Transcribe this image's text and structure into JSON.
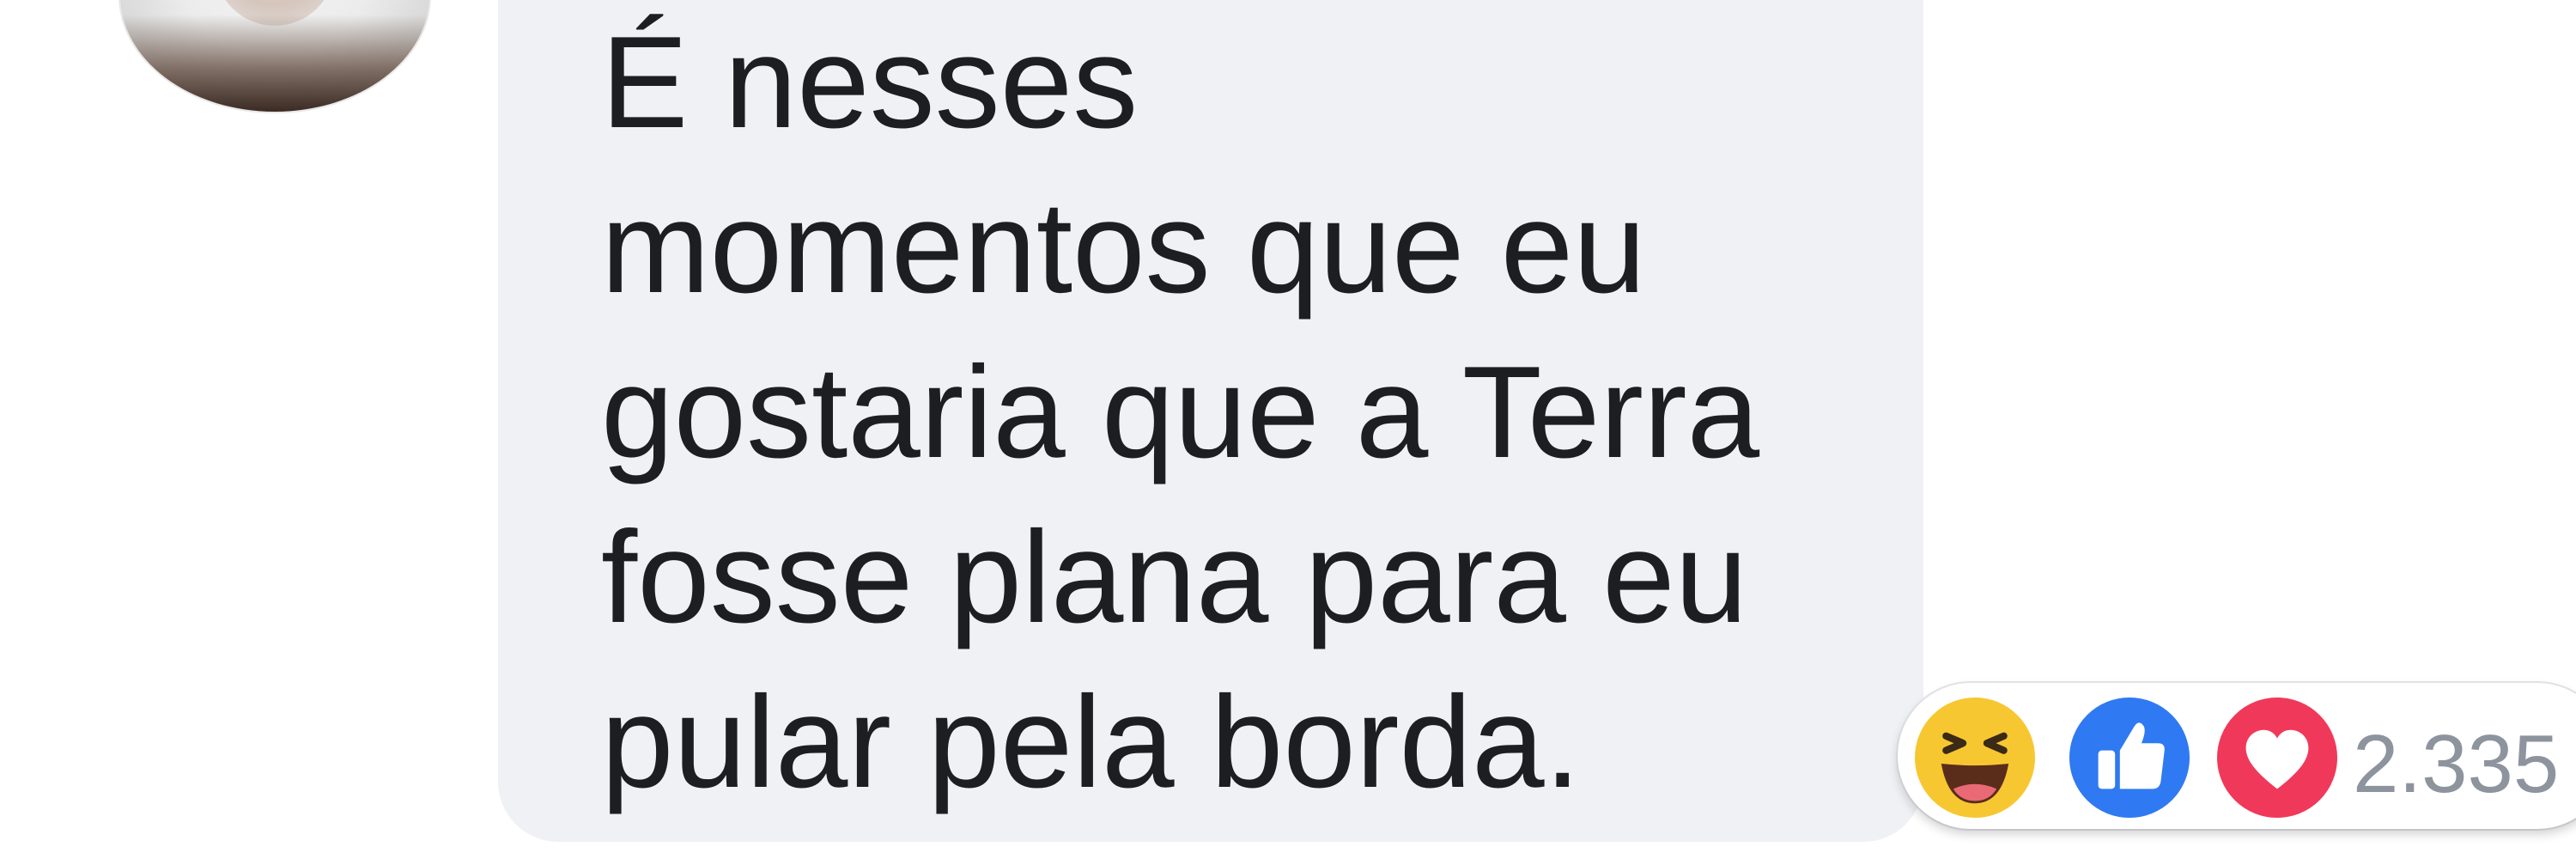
{
  "comment": {
    "lines": [
      "É nesses",
      "momentos que eu",
      "gostaria que a Terra",
      "fosse plana para eu",
      "pular pela borda."
    ]
  },
  "reactions": {
    "icons": [
      "haha-icon",
      "like-icon",
      "love-icon"
    ],
    "count": "2.335",
    "colors": {
      "haha": "#f7c731",
      "like": "#2f79f2",
      "love": "#f0395a"
    }
  },
  "colors": {
    "bubble": "#f0f1f5",
    "text": "#1c1e21",
    "count": "#8d949e"
  }
}
